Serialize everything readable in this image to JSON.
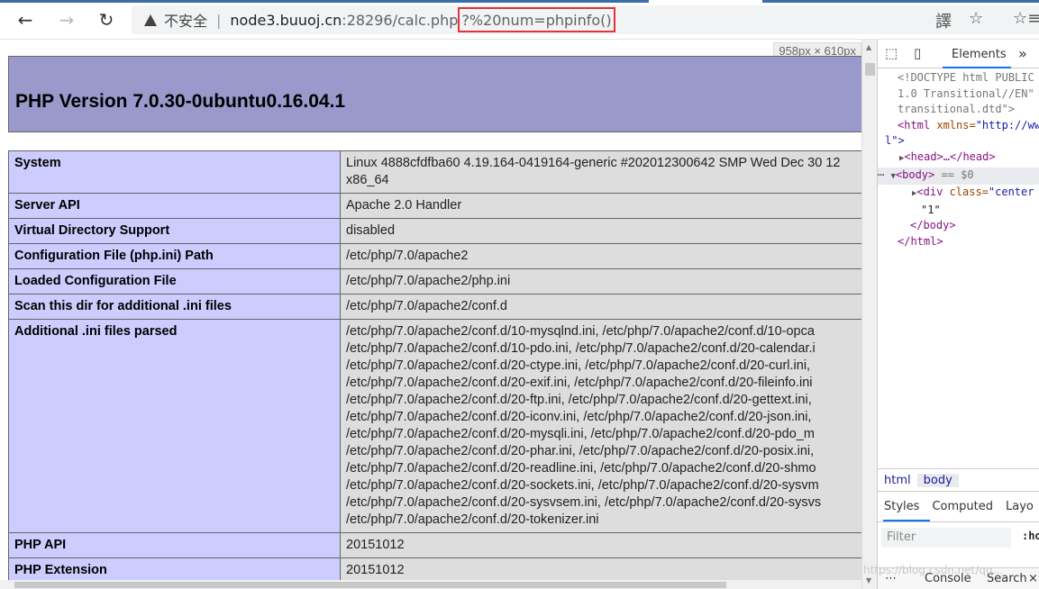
{
  "browser": {
    "security_label": "不安全",
    "separator": "|",
    "url_host": "node3.buuoj.cn",
    "url_path": ":28296/calc.php",
    "url_query": "?%20num=phpinfo()",
    "icons": {
      "back": "back-arrow-icon",
      "forward": "forward-arrow-icon",
      "reload": "reload-icon",
      "translate": "translate-icon",
      "favorite": "star-icon",
      "collections": "favorites-list-icon"
    },
    "highlight_color": "#e0343a"
  },
  "viewport_label": "958px × 610px",
  "phpinfo": {
    "title": "PHP Version 7.0.30-0ubuntu0.16.04.1",
    "rows": [
      {
        "key": "System",
        "value": "Linux 4888cfdfba60 4.19.164-0419164-generic #202012300642 SMP Wed Dec 30 12",
        "value2": "x86_64"
      },
      {
        "key": "Server API",
        "value": "Apache 2.0 Handler"
      },
      {
        "key": "Virtual Directory Support",
        "value": "disabled"
      },
      {
        "key": "Configuration File (php.ini) Path",
        "value": "/etc/php/7.0/apache2"
      },
      {
        "key": "Loaded Configuration File",
        "value": "/etc/php/7.0/apache2/php.ini"
      },
      {
        "key": "Scan this dir for additional .ini files",
        "value": "/etc/php/7.0/apache2/conf.d"
      }
    ],
    "ini_key": "Additional .ini files parsed",
    "ini_lines": [
      "/etc/php/7.0/apache2/conf.d/10-mysqlnd.ini, /etc/php/7.0/apache2/conf.d/10-opca",
      "/etc/php/7.0/apache2/conf.d/10-pdo.ini, /etc/php/7.0/apache2/conf.d/20-calendar.i",
      "/etc/php/7.0/apache2/conf.d/20-ctype.ini, /etc/php/7.0/apache2/conf.d/20-curl.ini,",
      "/etc/php/7.0/apache2/conf.d/20-exif.ini, /etc/php/7.0/apache2/conf.d/20-fileinfo.ini",
      "/etc/php/7.0/apache2/conf.d/20-ftp.ini, /etc/php/7.0/apache2/conf.d/20-gettext.ini,",
      "/etc/php/7.0/apache2/conf.d/20-iconv.ini, /etc/php/7.0/apache2/conf.d/20-json.ini,",
      "/etc/php/7.0/apache2/conf.d/20-mysqli.ini, /etc/php/7.0/apache2/conf.d/20-pdo_m",
      "/etc/php/7.0/apache2/conf.d/20-phar.ini, /etc/php/7.0/apache2/conf.d/20-posix.ini,",
      "/etc/php/7.0/apache2/conf.d/20-readline.ini, /etc/php/7.0/apache2/conf.d/20-shmo",
      "/etc/php/7.0/apache2/conf.d/20-sockets.ini, /etc/php/7.0/apache2/conf.d/20-sysvm",
      "/etc/php/7.0/apache2/conf.d/20-sysvsem.ini, /etc/php/7.0/apache2/conf.d/20-sysvs",
      "/etc/php/7.0/apache2/conf.d/20-tokenizer.ini"
    ],
    "rows_after": [
      {
        "key": "PHP API",
        "value": "20151012"
      },
      {
        "key": "PHP Extension",
        "value": "20151012"
      }
    ]
  },
  "devtools": {
    "tab_elements": "Elements",
    "more": "»",
    "dom": {
      "doctype_1": "<!DOCTYPE html PUBLIC",
      "doctype_2": "1.0 Transitional//EN\"",
      "doctype_3": "transitional.dtd\">",
      "html_open_tag": "<html",
      "html_attr": " xmlns=",
      "html_attr_val": "\"http://ww",
      "html_cont": "l\">",
      "head": "<head>…</head>",
      "body_open": "<body>",
      "body_eq": " == $0",
      "div_tag": "<div",
      "div_attr": " class=",
      "div_val": "\"center",
      "text_node": "\"1\"",
      "body_close": "</body>",
      "html_close": "</html>"
    },
    "crumbs": [
      "html",
      "body"
    ],
    "style_tabs": [
      "Styles",
      "Computed",
      "Layo"
    ],
    "filter_placeholder": "Filter",
    "filter_hov": ":ho",
    "drawer": {
      "dots": "⋯",
      "console": "Console",
      "search": "Search",
      "close": "×"
    }
  },
  "watermark": "https://blog.csdn.net/qq..."
}
